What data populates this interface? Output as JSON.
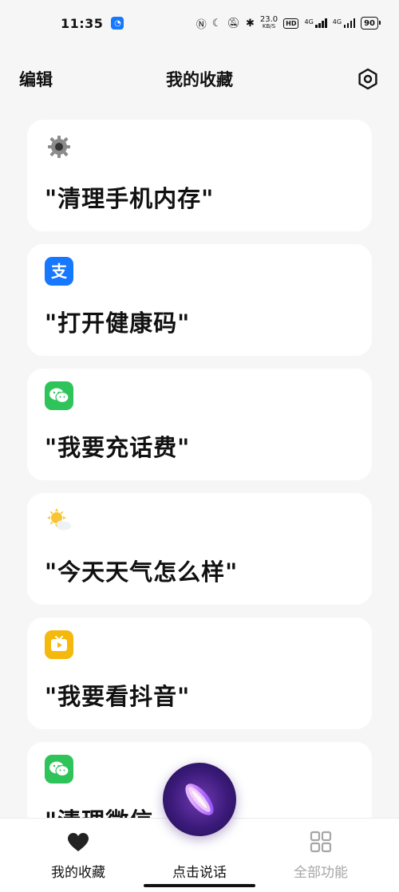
{
  "status_bar": {
    "time": "11:35",
    "net_speed_value": "23.0",
    "net_speed_unit": "KB/S",
    "hd": "HD",
    "signal1_label": "4G",
    "signal2_label": "4G",
    "battery": "90"
  },
  "header": {
    "edit_label": "编辑",
    "title": "我的收藏"
  },
  "cards": [
    {
      "text": "\"清理手机内存\"",
      "icon": "gear-icon"
    },
    {
      "text": "\"打开健康码\"",
      "icon": "alipay-icon"
    },
    {
      "text": "\"我要充话费\"",
      "icon": "wechat-icon"
    },
    {
      "text": "\"今天天气怎么样\"",
      "icon": "weather-icon"
    },
    {
      "text": "\"我要看抖音\"",
      "icon": "video-icon"
    },
    {
      "text": "\"清理微信",
      "icon": "wechat-icon"
    }
  ],
  "bottom_nav": {
    "favorites_label": "我的收藏",
    "talk_label": "点击说话",
    "all_features_label": "全部功能"
  },
  "colors": {
    "alipay": "#1677ff",
    "wechat": "#2ec45a",
    "video": "#f5b80c",
    "weather": "#f7c531",
    "inactive": "#a6a6a6"
  }
}
